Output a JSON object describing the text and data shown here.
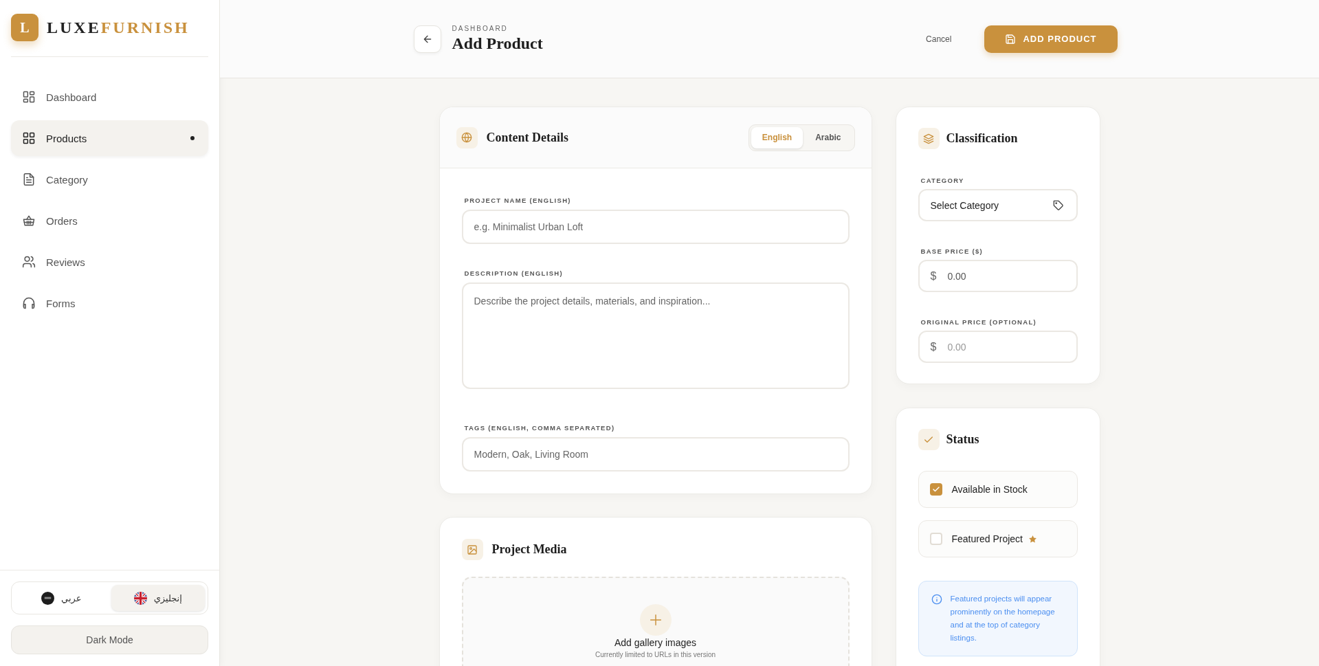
{
  "brand": {
    "logo_letter": "L",
    "name_dark": "LUXE",
    "name_accent": "FURNISH"
  },
  "sidebar": {
    "items": [
      {
        "label": "Dashboard",
        "kind": "layout",
        "selected": false
      },
      {
        "label": "Products",
        "kind": "grid",
        "selected": true
      },
      {
        "label": "Category",
        "kind": "file",
        "selected": false
      },
      {
        "label": "Orders",
        "kind": "basket",
        "selected": false
      },
      {
        "label": "Reviews",
        "kind": "users",
        "selected": false
      },
      {
        "label": "Forms",
        "kind": "headphones",
        "selected": false
      }
    ]
  },
  "language_switch": [
    {
      "label": "إنجليزي",
      "kind": "english",
      "selected": true
    },
    {
      "label": "عربي",
      "kind": "arabic",
      "selected": false
    }
  ],
  "dark_mode_button": "Dark Mode",
  "header": {
    "breadcrumb": "DASHBOARD",
    "title": "Add Product",
    "cancel": "Cancel",
    "submit": "ADD PRODUCT"
  },
  "content_details": {
    "title": "Content Details",
    "tabs": [
      {
        "label": "English",
        "selected": true
      },
      {
        "label": "Arabic",
        "selected": false
      }
    ],
    "fields": [
      {
        "label": "PROJECT NAME (ENGLISH)",
        "kind": "input",
        "placeholder": "e.g. Minimalist Urban Loft"
      },
      {
        "label": "DESCRIPTION (ENGLISH)",
        "kind": "textarea",
        "placeholder": "Describe the project details, materials, and inspiration..."
      },
      {
        "label": "TAGS (ENGLISH, COMMA SEPARATED)",
        "kind": "input",
        "placeholder": "Modern, Oak, Living Room"
      }
    ]
  },
  "project_media": {
    "title": "Project Media",
    "dropzone_title": "Add gallery images",
    "dropzone_note": "Currently limited to URLs in this version"
  },
  "classification": {
    "title": "Classification",
    "fields": [
      {
        "label": "CATEGORY",
        "kind": "select",
        "value": "Select Category"
      },
      {
        "label": "BASE PRICE ($)",
        "kind": "price",
        "prefix": "$",
        "value": "0.00"
      },
      {
        "label": "ORIGINAL PRICE (OPTIONAL)",
        "kind": "price",
        "prefix": "$",
        "placeholder": "0.00"
      }
    ]
  },
  "status": {
    "title": "Status",
    "options": [
      {
        "label": "Available in Stock",
        "checked": true,
        "starred": false
      },
      {
        "label": "Featured Project",
        "checked": false,
        "starred": true
      }
    ],
    "note": "Featured projects will appear prominently on the homepage and at the top of category listings."
  }
}
